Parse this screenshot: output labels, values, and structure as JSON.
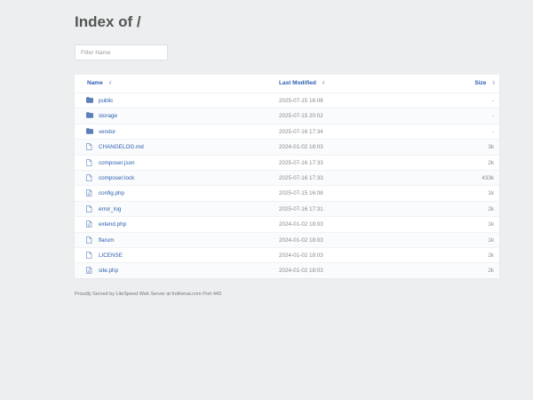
{
  "page": {
    "title": "Index of /"
  },
  "filter": {
    "placeholder": "Filter Name"
  },
  "table": {
    "headers": {
      "name": "Name",
      "modified": "Last Modified",
      "size": "Size",
      "sort_glyph": "⇕"
    },
    "rows": [
      {
        "type": "folder",
        "icon": "folder-icon",
        "name": "public",
        "modified": "2025-07-15 16:08",
        "size": "-"
      },
      {
        "type": "folder",
        "icon": "folder-icon",
        "name": "storage",
        "modified": "2025-07-15 20:02",
        "size": "-"
      },
      {
        "type": "folder",
        "icon": "folder-icon",
        "name": "vendor",
        "modified": "2025-07-16 17:34",
        "size": "-"
      },
      {
        "type": "file",
        "icon": "file-icon",
        "name": "CHANGELOG.md",
        "modified": "2024-01-02 18:03",
        "size": "3k"
      },
      {
        "type": "file",
        "icon": "file-icon",
        "name": "composer.json",
        "modified": "2025-07-16 17:33",
        "size": "2k"
      },
      {
        "type": "file",
        "icon": "file-icon",
        "name": "composer.lock",
        "modified": "2025-07-16 17:33",
        "size": "433k"
      },
      {
        "type": "code",
        "icon": "code-file-icon",
        "name": "config.php",
        "modified": "2025-07-15 16:08",
        "size": "1k"
      },
      {
        "type": "file",
        "icon": "file-icon",
        "name": "error_log",
        "modified": "2025-07-16 17:31",
        "size": "2k"
      },
      {
        "type": "code",
        "icon": "code-file-icon",
        "name": "extend.php",
        "modified": "2024-01-02 18:03",
        "size": "1k"
      },
      {
        "type": "file",
        "icon": "file-icon",
        "name": "flarum",
        "modified": "2024-01-02 18:03",
        "size": "1k"
      },
      {
        "type": "file",
        "icon": "file-icon",
        "name": "LICENSE",
        "modified": "2024-01-02 18:03",
        "size": "2k"
      },
      {
        "type": "code",
        "icon": "code-file-icon",
        "name": "site.php",
        "modified": "2024-01-02 18:03",
        "size": "2k"
      }
    ]
  },
  "footer": {
    "text": "Proudly Served by LiteSpeed Web Server at frothenai.com Port 443"
  },
  "colors": {
    "link": "#2a5db0",
    "icon": "#5b7fb8",
    "background": "#eceeef"
  }
}
